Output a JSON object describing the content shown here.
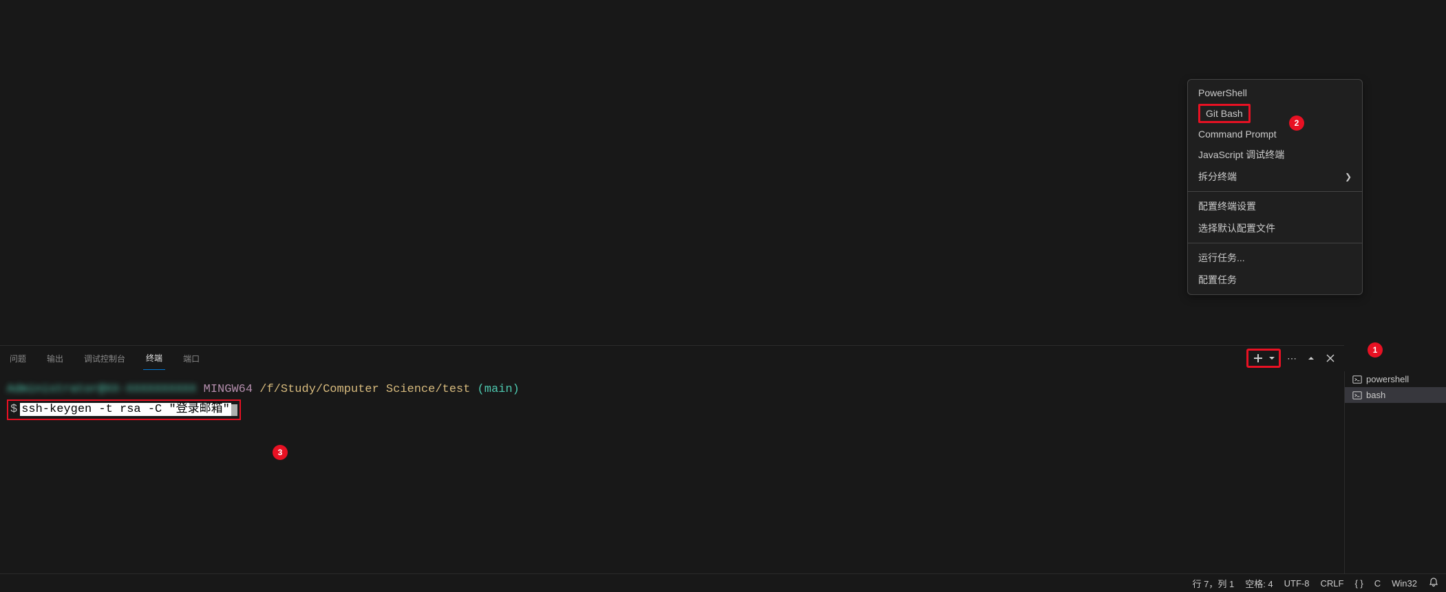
{
  "panel": {
    "tabs": {
      "problems": "问题",
      "output": "输出",
      "debug_console": "调试控制台",
      "terminal": "终端",
      "ports": "端口"
    }
  },
  "terminal": {
    "user_host": "Administrator@XX-XXXXXXXXXX",
    "mingw": "MINGW64",
    "path": "/f/Study/Computer Science/test",
    "branch": "(main)",
    "prompt": "$",
    "command": "ssh-keygen -t rsa -C \"登录邮箱\""
  },
  "context_menu": {
    "powershell": "PowerShell",
    "git_bash": "Git Bash",
    "command_prompt": "Command Prompt",
    "js_debug": "JavaScript 调试终端",
    "split_terminal": "拆分终端",
    "configure_settings": "配置终端设置",
    "select_default": "选择默认配置文件",
    "run_task": "运行任务...",
    "configure_task": "配置任务"
  },
  "terminal_list": {
    "powershell": "powershell",
    "bash": "bash"
  },
  "statusbar": {
    "line_col": "行 7，列 1",
    "spaces": "空格: 4",
    "encoding": "UTF-8",
    "eol": "CRLF",
    "braces": "{ }",
    "lang": "C",
    "platform": "Win32"
  },
  "callouts": {
    "c1": "1",
    "c2": "2",
    "c3": "3"
  }
}
